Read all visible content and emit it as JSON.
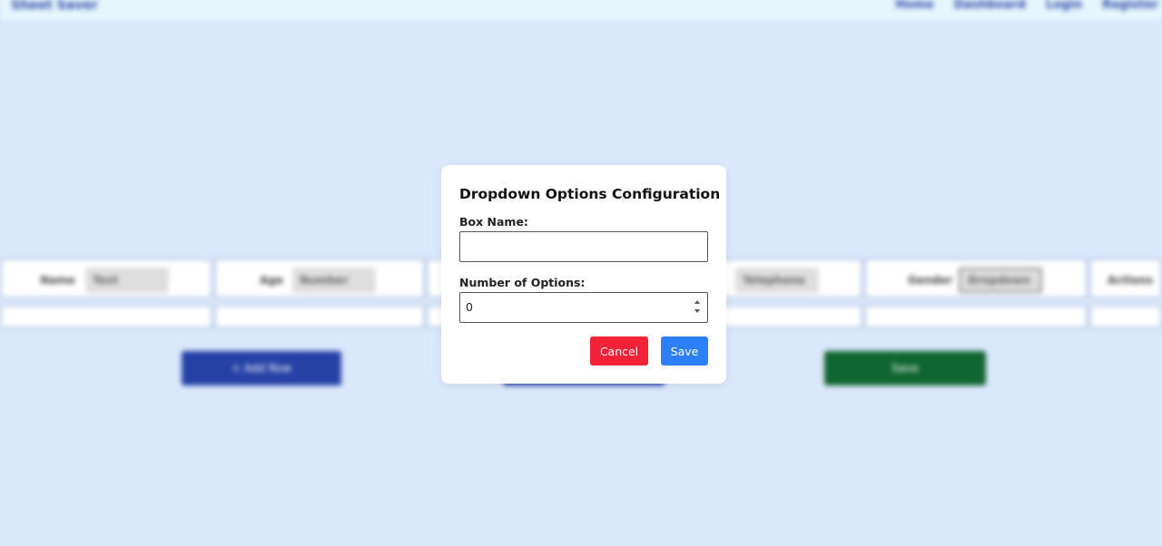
{
  "background": {
    "brand": "Sheet Saver",
    "nav_links": [
      "Home",
      "Dashboard",
      "Login",
      "Register"
    ],
    "columns": [
      {
        "name": "Name",
        "type": "Text"
      },
      {
        "name": "Age",
        "type": "Number"
      },
      {
        "name": "",
        "type": ""
      },
      {
        "name": "",
        "type": "Telephone"
      },
      {
        "name": "Gender",
        "type": "Dropdown"
      },
      {
        "name": "Actions",
        "type": ""
      }
    ],
    "buttons": {
      "add_row": "+ Add Row",
      "middle": "",
      "save": "Save"
    },
    "colors": {
      "page_bg": "#dae8fc",
      "add_row": "#2541a5",
      "save": "#0f6630"
    }
  },
  "modal": {
    "title": "Dropdown Options Configuration",
    "box_name_label": "Box Name:",
    "box_name_value": "",
    "num_options_label": "Number of Options:",
    "num_options_value": "0",
    "cancel_label": "Cancel",
    "save_label": "Save",
    "colors": {
      "cancel": "#f42236",
      "save": "#2d7ff9"
    }
  }
}
